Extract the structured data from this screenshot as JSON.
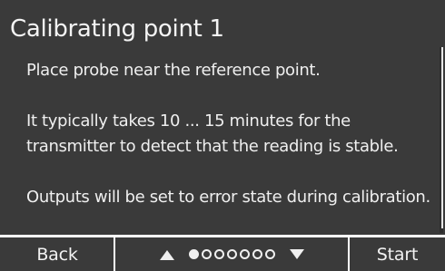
{
  "screen": {
    "title": "Calibrating point 1",
    "paragraphs": [
      "Place probe near the reference point.",
      "It typically takes 10 ... 15 minutes for the transmitter to detect that the reading is stable.",
      "Outputs will be set to error state during calibration."
    ]
  },
  "softkeys": {
    "left_label": "Back",
    "right_label": "Start",
    "page_total": 7,
    "page_current": 1
  },
  "colors": {
    "background": "#3a3a3a",
    "text": "#f2f2f2",
    "separator": "#ffffff"
  }
}
